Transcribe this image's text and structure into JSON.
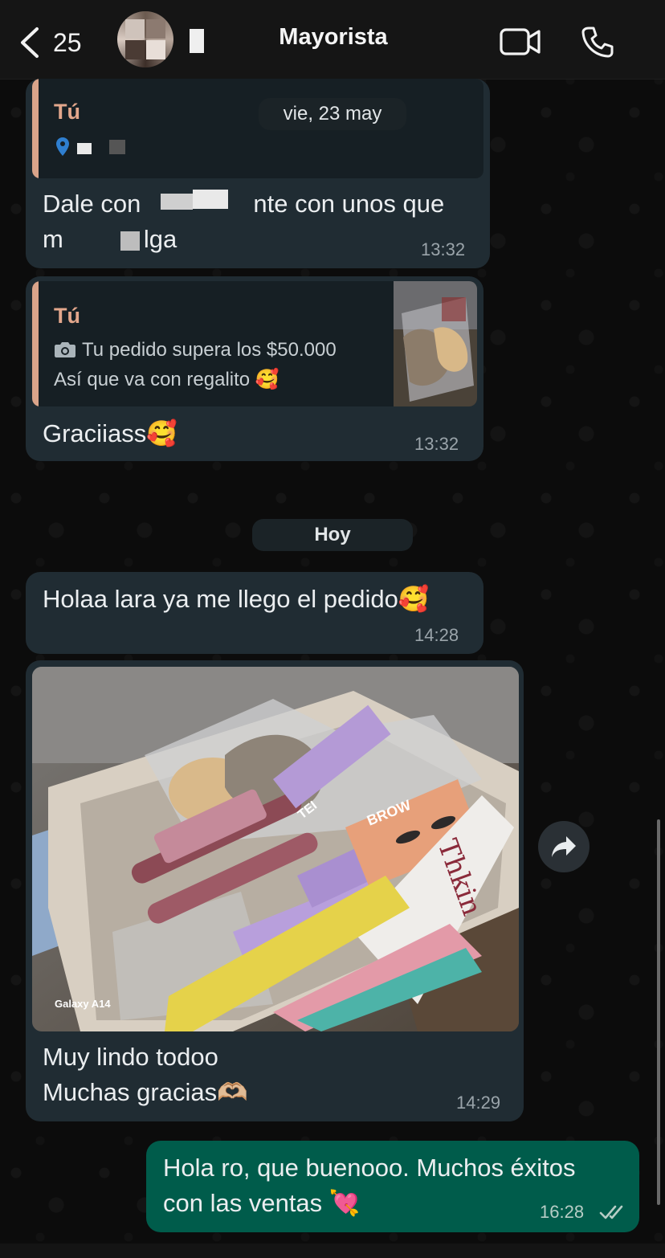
{
  "header": {
    "back_count": "25",
    "title": "Mayorista"
  },
  "messages": {
    "first": {
      "quote_author": "Tú",
      "date_pill": "vie, 23 may",
      "text_line1": "Dale con",
      "text_line1_end": "nte con unos que",
      "text_line2": "m",
      "text_line2_end": "lga",
      "time": "13:32"
    },
    "second": {
      "quote_author": "Tú",
      "quote_line1": "Tu pedido supera los $50.000",
      "quote_line2": "Así que va con regalito 🥰",
      "text": "Graciiass🥰",
      "time": "13:32"
    },
    "today_pill": "Hoy",
    "third": {
      "text": "Holaa lara ya me llego el pedido🥰",
      "time": "14:28"
    },
    "fourth": {
      "photo_watermark": "Galaxy A14",
      "text_line1": "Muy lindo todoo",
      "text_line2": "Muchas gracias🫶🏼",
      "time": "14:29"
    },
    "fifth": {
      "text_line1": "Hola ro, que buenooo. Muchos éxitos",
      "text_line2": "con las ventas 💘",
      "time": "16:28"
    }
  },
  "photo_labels": {
    "brow": "BROW",
    "thkin": "Thkin",
    "tei": "TEI"
  },
  "colors": {
    "incoming_bubble": "#202c33",
    "outgoing_bubble": "#005c4b",
    "quote_accent": "#d9a48a",
    "read_ticks": "#9aa4aa"
  },
  "icons": {
    "back": "chevron-left-icon",
    "video": "video-camera-icon",
    "phone": "phone-icon",
    "camera": "camera-icon",
    "forward": "forward-arrow-icon",
    "ticks": "double-check-icon"
  }
}
